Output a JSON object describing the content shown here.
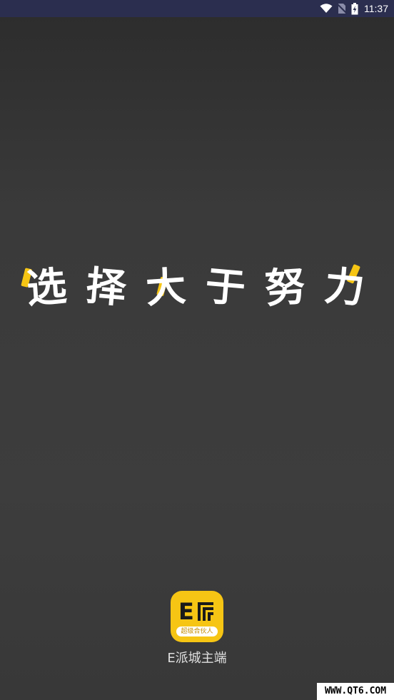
{
  "status_bar": {
    "time": "11:37",
    "icons": [
      "wifi-icon",
      "no-sim-icon",
      "battery-charging-icon"
    ]
  },
  "slogan": {
    "chars": [
      "选",
      "择",
      "大",
      "于",
      "努",
      "力"
    ],
    "accent_color": "#f6c514"
  },
  "app": {
    "icon_letter": "E",
    "icon_tagline": "超级合伙人",
    "name": "E派城主端",
    "brand_color": "#f6c514"
  },
  "watermark": {
    "text": "WWW.QT6.COM"
  }
}
